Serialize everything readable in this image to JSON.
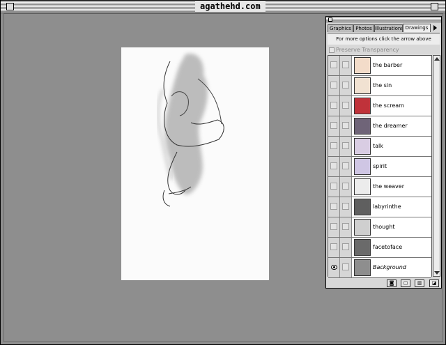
{
  "window": {
    "title": "agathehd.com"
  },
  "palette": {
    "tabs": [
      "Graphics",
      "Photos",
      "Illustrations",
      "Drawings"
    ],
    "active_tab": "Drawings",
    "hint": "For more options click the arrow above",
    "preserve_label": "Preserve Transparency",
    "layers": [
      {
        "name": "the barber",
        "thumb_color": "#f3dcc9"
      },
      {
        "name": "the sin",
        "thumb_color": "#f1e2d2"
      },
      {
        "name": "the scream",
        "thumb_color": "#c0323a"
      },
      {
        "name": "the dreamer",
        "thumb_color": "#6f6478"
      },
      {
        "name": "talk",
        "thumb_color": "#d9cde3"
      },
      {
        "name": "spirit",
        "thumb_color": "#cfc6e4"
      },
      {
        "name": "the weaver",
        "thumb_color": "#ececec"
      },
      {
        "name": "labyrinthe",
        "thumb_color": "#5f5f5f"
      },
      {
        "name": "thought",
        "thumb_color": "#cfcfcf"
      },
      {
        "name": "facetoface",
        "thumb_color": "#6a6a6a"
      },
      {
        "name": "Background",
        "thumb_color": "#8e8e8e"
      }
    ],
    "buttons": [
      "mask-icon",
      "new-layer-icon",
      "trash-icon",
      "resize-icon"
    ]
  }
}
